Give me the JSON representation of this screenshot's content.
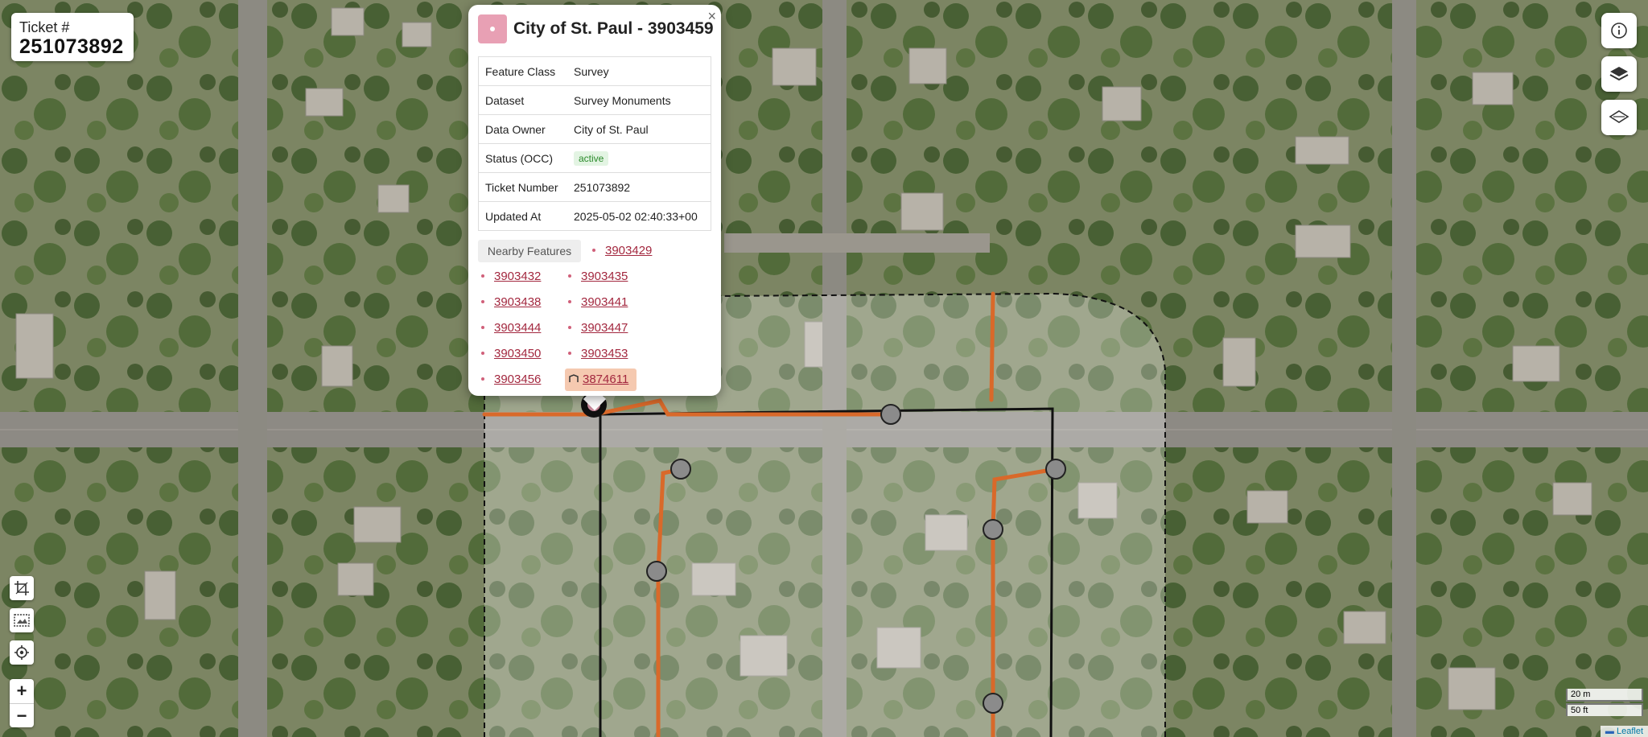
{
  "ticket": {
    "label": "Ticket #",
    "number": "251073892"
  },
  "popup": {
    "title": "City of St. Paul - 3903459",
    "close": "×",
    "attributes": [
      {
        "key": "Feature Class",
        "value": "Survey"
      },
      {
        "key": "Dataset",
        "value": "Survey Monuments"
      },
      {
        "key": "Data Owner",
        "value": "City of St. Paul"
      },
      {
        "key": "Status (OCC)",
        "value": "active"
      },
      {
        "key": "Ticket Number",
        "value": "251073892"
      },
      {
        "key": "Updated At",
        "value": "2025-05-02 02:40:33+00"
      }
    ],
    "nearby_label": "Nearby Features",
    "nearby": [
      "3903429",
      "3903432",
      "3903435",
      "3903438",
      "3903441",
      "3903444",
      "3903447",
      "3903450",
      "3903453",
      "3903456",
      "3874611"
    ]
  },
  "controls": {
    "info_icon": "info-icon",
    "layers_icon": "layers-icon",
    "basemap_icon": "basemap-icon",
    "zoom_in": "+",
    "zoom_out": "−"
  },
  "scale": {
    "metric": "20 m",
    "imperial": "50 ft"
  },
  "attribution": "Leaflet",
  "colors": {
    "accent": "#a3283f",
    "orange_line": "#d9692a",
    "marker": "#e8a0b4"
  }
}
